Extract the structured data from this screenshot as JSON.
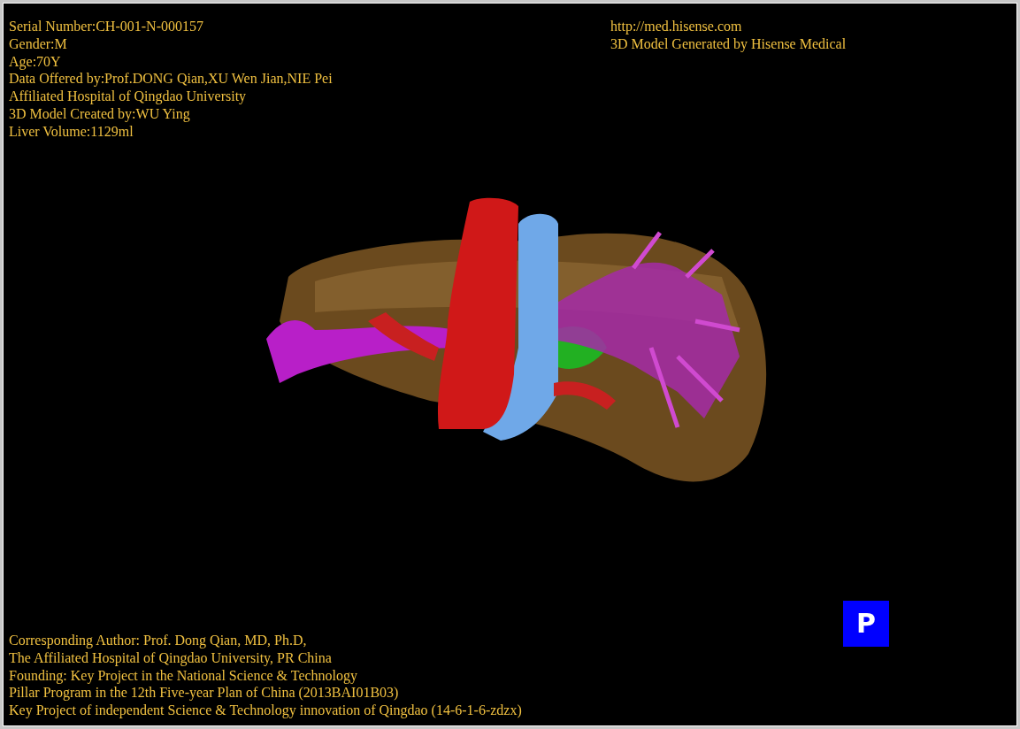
{
  "patient_info": [
    "Serial Number:CH-001-N-000157",
    "Gender:M",
    "Age:70Y",
    "Data Offered by:Prof.DONG Qian,XU Wen Jian,NIE Pei",
    "Affiliated Hospital of Qingdao University",
    "3D Model Created by:WU Ying",
    "Liver Volume:1129ml"
  ],
  "vendor_info": [
    "http://med.hisense.com",
    "3D Model Generated by Hisense Medical"
  ],
  "credits": [
    "Corresponding Author: Prof. Dong Qian, MD, Ph.D,",
    "The Affiliated Hospital of Qingdao University, PR China",
    "Founding: Key Project in the National Science & Technology",
    "Pillar Program in the 12th Five-year Plan of China (2013BAI01B03)",
    "Key Project of independent Science & Technology innovation of Qingdao (14-6-1-6-zdzx)"
  ],
  "projection_button": {
    "label": "P"
  }
}
